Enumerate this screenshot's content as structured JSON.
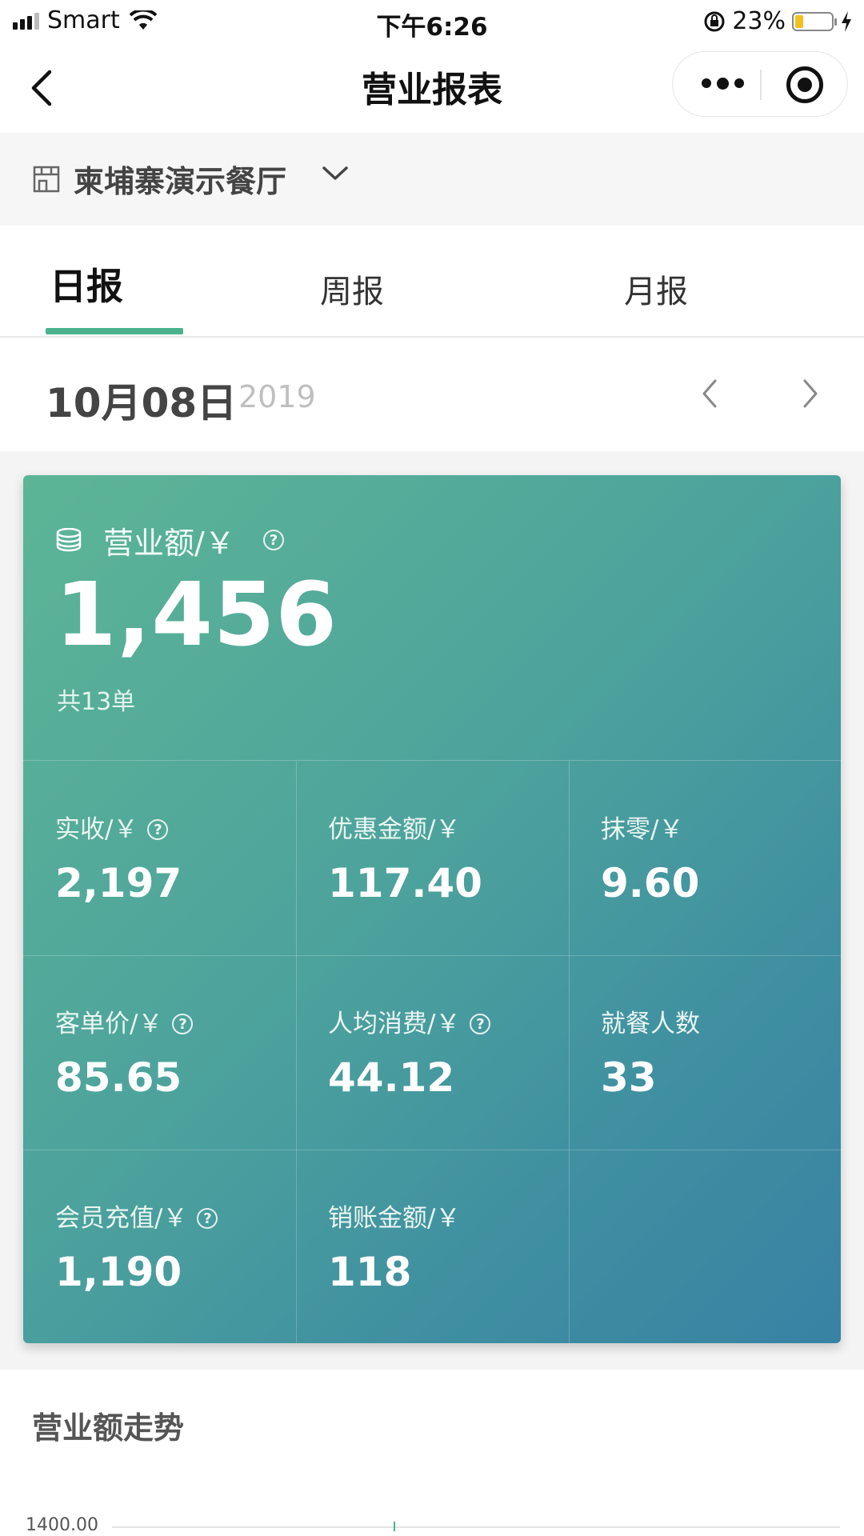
{
  "status_bar": {
    "carrier": "Smart",
    "time": "下午6:26",
    "battery_percent": "23%",
    "battery_level": 0.23,
    "icons": [
      "signal-icon",
      "wifi-icon",
      "rotation-lock-icon",
      "battery-icon",
      "charging-icon"
    ]
  },
  "nav": {
    "title": "营业报表",
    "back_icon": "chevron-left-icon",
    "more_icon": "more-dots-icon",
    "close_icon": "target-icon"
  },
  "store": {
    "name": "柬埔寨演示餐厅",
    "icon": "store-icon",
    "dropdown_icon": "chevron-down-icon"
  },
  "tabs": [
    {
      "label": "日报",
      "active": true
    },
    {
      "label": "周报",
      "active": false
    },
    {
      "label": "月报",
      "active": false
    }
  ],
  "date": {
    "main": "10月08日",
    "year": "2019"
  },
  "summary": {
    "revenue_label": "营业额/￥",
    "revenue_value": "1,456",
    "orders_text": "共13单",
    "metrics": [
      {
        "label": "实收/￥",
        "value": "2,197",
        "help": true
      },
      {
        "label": "优惠金额/￥",
        "value": "117.40",
        "help": false
      },
      {
        "label": "抹零/￥",
        "value": "9.60",
        "help": false
      },
      {
        "label": "客单价/￥",
        "value": "85.65",
        "help": true
      },
      {
        "label": "人均消费/￥",
        "value": "44.12",
        "help": true
      },
      {
        "label": "就餐人数",
        "value": "33",
        "help": false
      },
      {
        "label": "会员充值/￥",
        "value": "1,190",
        "help": true
      },
      {
        "label": "销账金额/￥",
        "value": "118",
        "help": false
      }
    ]
  },
  "trend": {
    "title": "营业额走势",
    "y_axis_top": "1400.00"
  },
  "colors": {
    "accent": "#4ab38e",
    "card_gradient_start": "#5db596",
    "card_gradient_end": "#3882a4"
  }
}
